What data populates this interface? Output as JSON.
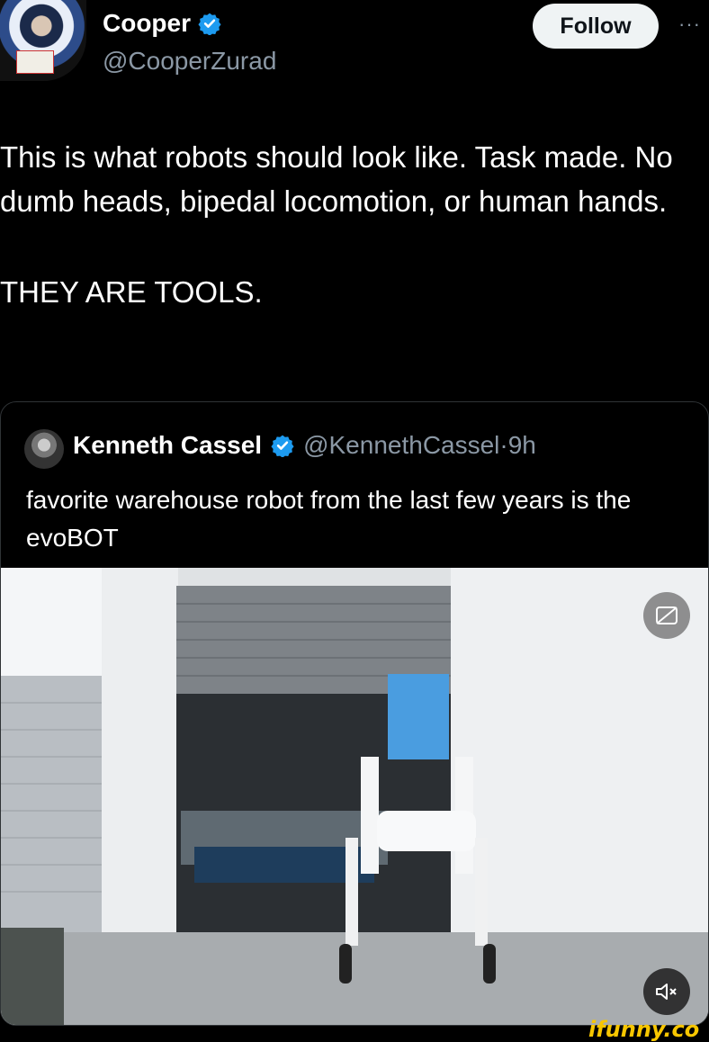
{
  "author": {
    "name": "Cooper",
    "handle": "@CooperZurad",
    "verified": true
  },
  "follow_label": "Follow",
  "more_label": "···",
  "tweet": {
    "lines": [
      "This is what robots should look like. Task made. No dumb heads, bipedal locomotion, or human hands.",
      "THEY ARE TOOLS."
    ]
  },
  "quoted": {
    "name": "Kenneth Cassel",
    "handle": "@KennethCassel",
    "separator": "·",
    "time": "9h",
    "text": "favorite warehouse robot from the last few years is the evoBOT"
  },
  "media": {
    "cc_icon": "cc-icon",
    "mute_icon": "speaker-mute-icon"
  },
  "watermark": "ifunny.co",
  "colors": {
    "background": "#000000",
    "text": "#ffffff",
    "secondary": "#8b98a5",
    "verified": "#1d9bf0",
    "watermark": "#f7c600"
  }
}
